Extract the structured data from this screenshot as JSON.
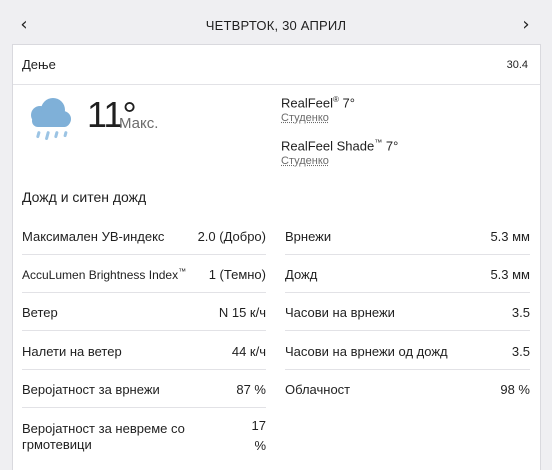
{
  "nav": {
    "prev_icon": "chevron-left-icon",
    "prev_glyph": "‹",
    "next_icon": "chevron-right-icon",
    "next_glyph": "›",
    "date": "ЧЕТВРТОК, 30 АПРИЛ"
  },
  "header": {
    "label": "Дење",
    "date": "30.4"
  },
  "current": {
    "icon": "cloud-rain-icon",
    "temperature": "11°",
    "temp_label": "Макс.",
    "realfeel_label": "RealFeel",
    "realfeel_mark": "®",
    "realfeel_value": " 7°",
    "realfeel_phrase": "Студенко",
    "realfeel_shade_label": "RealFeel Shade",
    "realfeel_shade_mark": "™",
    "realfeel_shade_value": " 7°",
    "realfeel_shade_phrase": "Студенко",
    "phrase": "Дожд и ситен дожд"
  },
  "details_left": [
    {
      "label": "Максимален УВ-индекс",
      "value": "2.0 (Добро)"
    },
    {
      "label": "AccuLumen Brightness Index",
      "mark": "™",
      "value": "1 (Темно)"
    },
    {
      "label": "Ветер",
      "value": "N 15 к/ч"
    },
    {
      "label": "Налети на ветер",
      "value": "44 к/ч"
    },
    {
      "label": "Веројатност за врнежи",
      "value": "87 %"
    },
    {
      "label": "Веројатност за невреме со грмотевици",
      "value": "17 %"
    }
  ],
  "details_right": [
    {
      "label": "Врнежи",
      "value": "5.3 мм"
    },
    {
      "label": "Дожд",
      "value": "5.3 мм"
    },
    {
      "label": "Часови на врнежи",
      "value": "3.5"
    },
    {
      "label": "Часови на врнежи од дожд",
      "value": "3.5"
    },
    {
      "label": "Облачност",
      "value": "98 %"
    }
  ]
}
